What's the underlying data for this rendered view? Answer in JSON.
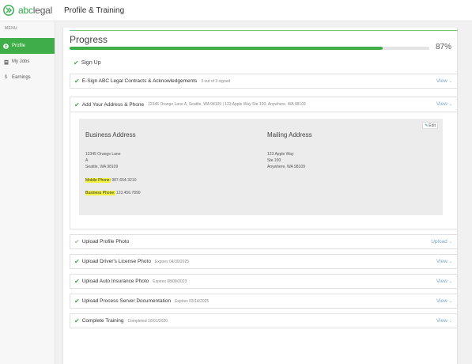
{
  "app": {
    "logo_text_prefix": "abc",
    "logo_text_suffix": "legal",
    "page_title": "Profile & Training",
    "brand_color": "#3fae49"
  },
  "sidebar": {
    "menu_label": "MENU",
    "items": [
      {
        "label": "Profile",
        "icon": "user-icon",
        "active": true
      },
      {
        "label": "My Jobs",
        "icon": "clipboard-icon",
        "active": false
      },
      {
        "label": "Earnings",
        "icon": "dollar-icon",
        "active": false
      }
    ]
  },
  "progress": {
    "title": "Progress",
    "percent_label": "87%",
    "percent": 87
  },
  "signup": {
    "label": "Sign Up"
  },
  "rows": [
    {
      "label": "E-Sign ABC Legal Contracts & Acknowledgements",
      "sub": "3 out of 3 signed",
      "action": "View",
      "checked": true
    },
    {
      "label": "Add Your Address & Phone",
      "sub": "12345 Orange Lane A, Seattle, WA 98109 | 123 Apple Way Ste 100, Anywhere, WA 98109",
      "action": "View",
      "checked": true
    },
    {
      "label": "Upload Profile Photo",
      "sub": "",
      "action": "Upload",
      "checked": true
    },
    {
      "label": "Upload Driver's License Photo",
      "sub": "Expires 04/30/2025",
      "action": "View",
      "checked": true
    },
    {
      "label": "Upload Auto Insurance Photo",
      "sub": "Expires 08/08/2023",
      "action": "View",
      "checked": true
    },
    {
      "label": "Upload Process Server Documentation",
      "sub": "Expires 03/14/2025",
      "action": "View",
      "checked": true
    },
    {
      "label": "Complete Training",
      "sub": "Completed 10/01/2020",
      "action": "View",
      "checked": true
    }
  ],
  "address": {
    "edit_label": "Edit",
    "business": {
      "title": "Business Address",
      "line1": "12345 Orange Lane",
      "line2": "A",
      "line3": "Seattle, WA 98109"
    },
    "mailing": {
      "title": "Mailing Address",
      "line1": "123 Apple Way",
      "line2": "Ste 100",
      "line3": "Anywhere, WA 98109"
    },
    "mobile_label": "Mobile Phone:",
    "mobile_value": "987-654-3210",
    "business_phone_label": "Business Phone:",
    "business_phone_value": "123.456.7890"
  }
}
